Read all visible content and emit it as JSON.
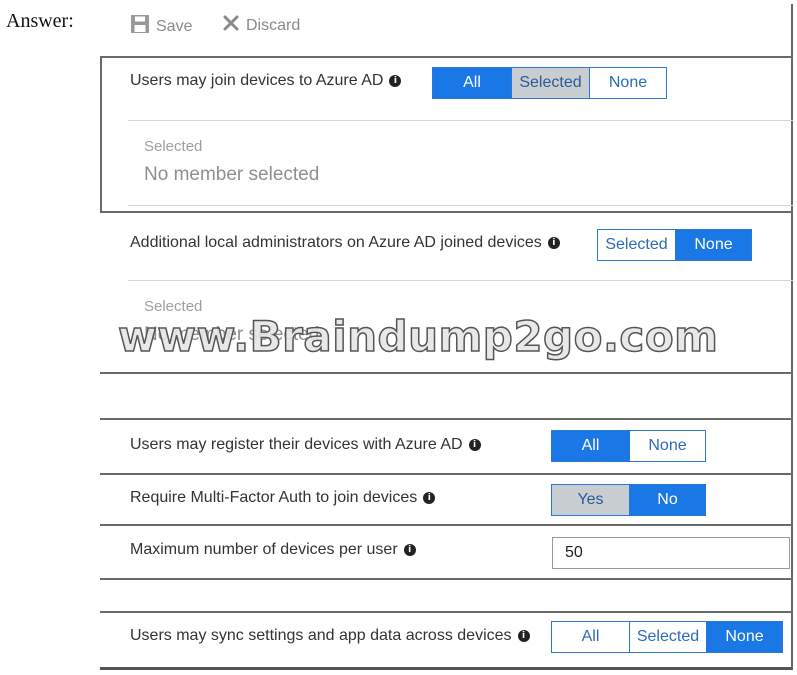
{
  "answer_label": "Answer:",
  "toolbar": {
    "save_label": "Save",
    "discard_label": "Discard"
  },
  "join": {
    "label": "Users may join devices to Azure AD",
    "options": [
      "All",
      "Selected",
      "None"
    ],
    "selected_caption": "Selected",
    "member_text": "No member selected"
  },
  "local_admins": {
    "label": "Additional local administrators on Azure AD joined devices",
    "options": [
      "Selected",
      "None"
    ],
    "selected_caption": "Selected",
    "member_text": "No member selected"
  },
  "register": {
    "label": "Users may register their devices with Azure AD",
    "options": [
      "All",
      "None"
    ]
  },
  "mfa": {
    "label": "Require Multi-Factor Auth to join devices",
    "options": [
      "Yes",
      "No"
    ]
  },
  "max_devices": {
    "label": "Maximum number of devices per user",
    "value": "50"
  },
  "sync": {
    "label": "Users may sync settings and app data across devices",
    "options": [
      "All",
      "Selected",
      "None"
    ]
  },
  "watermark": "www.Braindump2go.com",
  "colors": {
    "accent": "#1978e6",
    "highlight": "#c8cdd2"
  }
}
